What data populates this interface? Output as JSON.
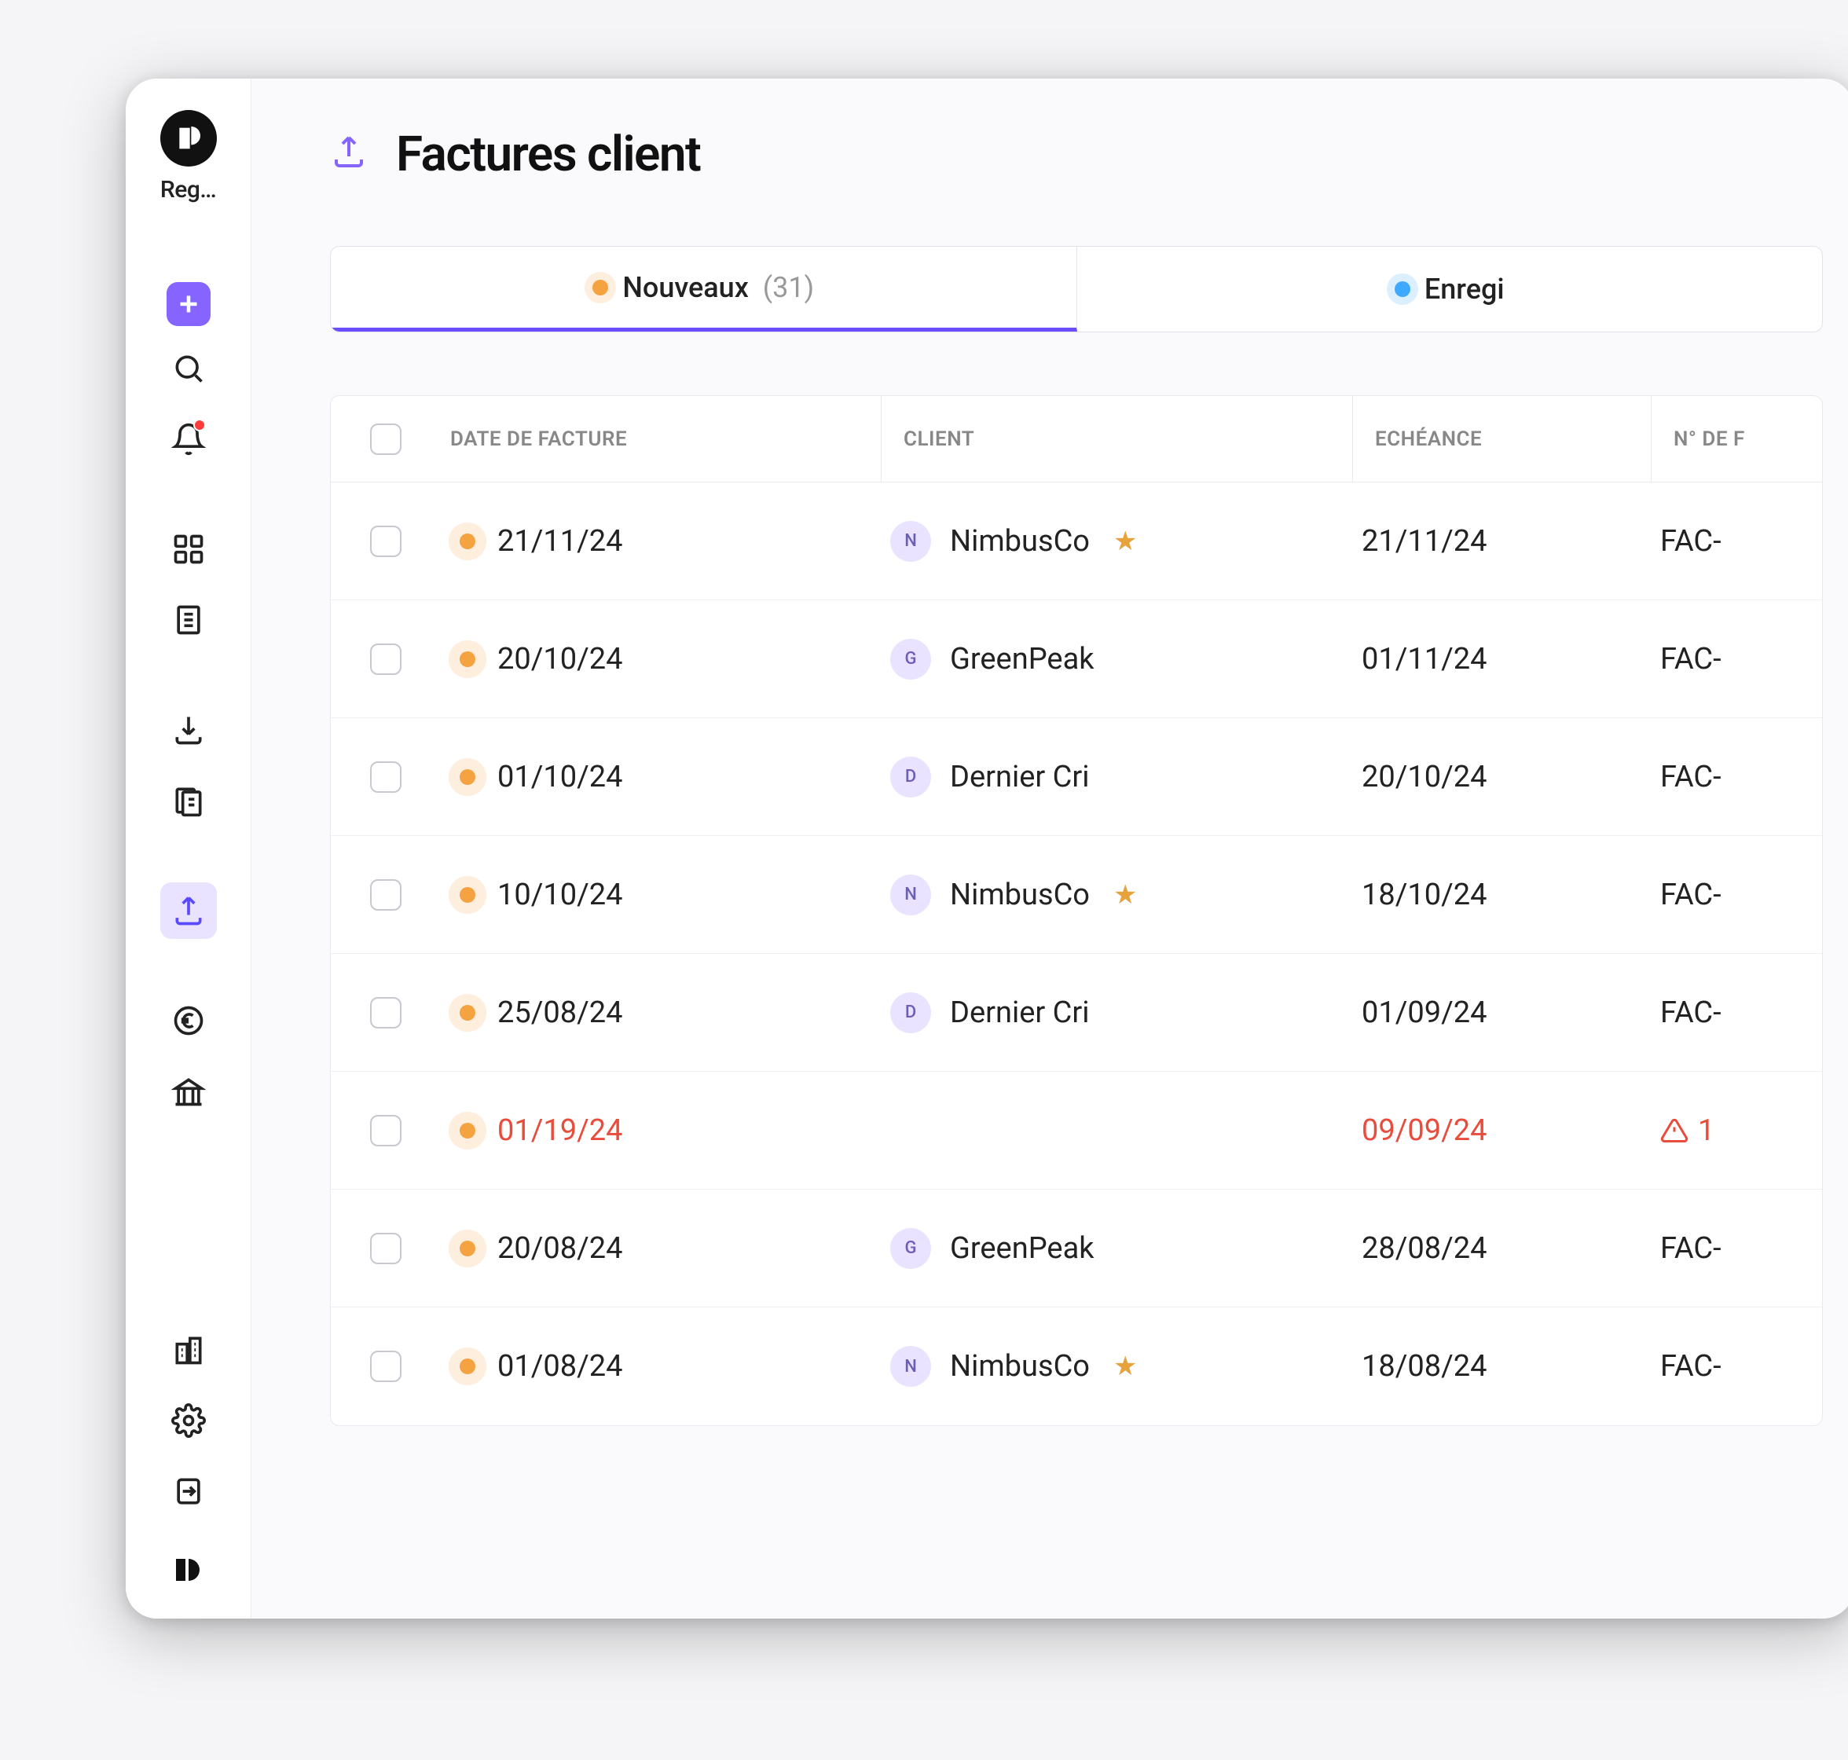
{
  "sidebar": {
    "logo_label": "Reg…"
  },
  "page": {
    "title": "Factures client"
  },
  "tabs": [
    {
      "label": "Nouveaux",
      "count": "(31)",
      "color": "orange",
      "active": true
    },
    {
      "label": "Enregi",
      "count": "",
      "color": "blue",
      "active": false
    }
  ],
  "table": {
    "headers": {
      "date": "DATE DE FACTURE",
      "client": "CLIENT",
      "due": "ECHÉANCE",
      "num": "N° DE F"
    },
    "rows": [
      {
        "date": "21/11/24",
        "client": "NimbusCo",
        "initial": "N",
        "starred": true,
        "due": "21/11/24",
        "num": "FAC-",
        "error": false
      },
      {
        "date": "20/10/24",
        "client": "GreenPeak",
        "initial": "G",
        "starred": false,
        "due": "01/11/24",
        "num": "FAC-",
        "error": false
      },
      {
        "date": "01/10/24",
        "client": "Dernier Cri",
        "initial": "D",
        "starred": false,
        "due": "20/10/24",
        "num": "FAC-",
        "error": false
      },
      {
        "date": "10/10/24",
        "client": "NimbusCo",
        "initial": "N",
        "starred": true,
        "due": "18/10/24",
        "num": "FAC-",
        "error": false
      },
      {
        "date": "25/08/24",
        "client": "Dernier Cri",
        "initial": "D",
        "starred": false,
        "due": "01/09/24",
        "num": "FAC-",
        "error": false
      },
      {
        "date": "01/19/24",
        "client": "",
        "initial": "",
        "starred": false,
        "due": "09/09/24",
        "num": "1",
        "error": true
      },
      {
        "date": "20/08/24",
        "client": "GreenPeak",
        "initial": "G",
        "starred": false,
        "due": "28/08/24",
        "num": "FAC-",
        "error": false
      },
      {
        "date": "01/08/24",
        "client": "NimbusCo",
        "initial": "N",
        "starred": true,
        "due": "18/08/24",
        "num": "FAC-",
        "error": false
      }
    ]
  }
}
